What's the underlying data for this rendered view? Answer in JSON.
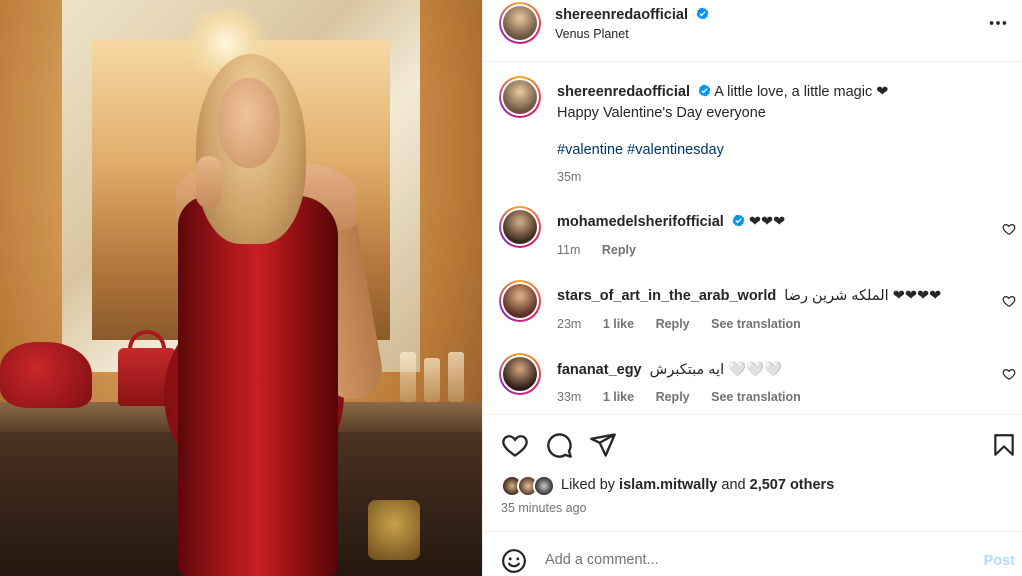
{
  "post": {
    "author": "shereenredaofficial",
    "location": "Venus Planet",
    "caption_line1": "A little love, a little magic ❤",
    "caption_line2": "Happy Valentine's Day everyone",
    "hashtags": "#valentine #valentinesday",
    "caption_time": "35m"
  },
  "comments": [
    {
      "user": "mohamedelsherifofficial",
      "text": "❤❤❤",
      "time": "11m",
      "likes": "",
      "reply": "Reply",
      "translate": "",
      "verified": true
    },
    {
      "user": "stars_of_art_in_the_arab_world",
      "text": "الملكه شرين رضا ❤❤❤❤",
      "time": "23m",
      "likes": "1 like",
      "reply": "Reply",
      "translate": "See translation",
      "verified": false
    },
    {
      "user": "fananat_egy",
      "text": "ايه مبتكبرش 🤍🤍🤍",
      "time": "33m",
      "likes": "1 like",
      "reply": "Reply",
      "translate": "See translation",
      "verified": false
    }
  ],
  "likes": {
    "prefix": "Liked by",
    "user": "islam.mitwally",
    "and": "and",
    "others": "2,507 others",
    "posted_ago": "35 minutes ago"
  },
  "comment_box": {
    "placeholder": "Add a comment...",
    "post_label": "Post"
  },
  "colors": {
    "verified": "#0095f6",
    "link": "#00376b",
    "muted": "#737373",
    "post_disabled": "#b3dbff"
  },
  "icons": [
    "more-options-icon",
    "verified-badge-icon",
    "like-heart-icon",
    "comment-icon",
    "share-icon",
    "save-bookmark-icon",
    "emoji-icon"
  ]
}
